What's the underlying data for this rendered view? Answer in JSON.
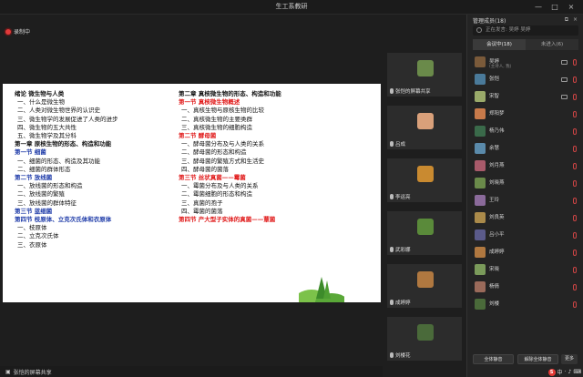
{
  "window": {
    "title": "生工系教研",
    "controls": [
      "—",
      "□",
      "×"
    ]
  },
  "recording": {
    "label": "录制中"
  },
  "slide": {
    "left": [
      {
        "text": "绪论 微生物与人类",
        "style": "h1"
      },
      {
        "text": "一、什么是微生物",
        "style": "ind"
      },
      {
        "text": "二、人类对微生物世界的认识史",
        "style": "ind"
      },
      {
        "text": "三、微生物学的发展促进了人类的进步",
        "style": "ind"
      },
      {
        "text": "四、微生物的五大共性",
        "style": "ind"
      },
      {
        "text": "五、微生物学及其分科",
        "style": "ind"
      },
      {
        "text": "第一章 原核生物的形态、构造和功能",
        "style": "h1"
      },
      {
        "text": "第一节 细菌",
        "style": "blue"
      },
      {
        "text": "一、细菌的形态、构造及其功能",
        "style": "ind"
      },
      {
        "text": "二、细菌的群体形态",
        "style": "ind"
      },
      {
        "text": "第二节 放线菌",
        "style": "blue"
      },
      {
        "text": "一、放线菌的形态和构造",
        "style": "ind"
      },
      {
        "text": "二、放线菌的繁殖",
        "style": "ind"
      },
      {
        "text": "三、放线菌的群体特征",
        "style": "ind"
      },
      {
        "text": "第三节 蓝细菌",
        "style": "blue"
      },
      {
        "text": "第四节 枝原体、立克次氏体和衣原体",
        "style": "blue"
      },
      {
        "text": "一、枝原体",
        "style": "ind"
      },
      {
        "text": "二、立克次氏体",
        "style": "ind"
      },
      {
        "text": "三、衣原体",
        "style": "ind"
      }
    ],
    "right": [
      {
        "text": "第二章 真核微生物的形态、构造和功能",
        "style": "h1"
      },
      {
        "text": "第一节 真核微生物概述",
        "style": "sec"
      },
      {
        "text": "一、真核生物与原核生物的比较",
        "style": "ind"
      },
      {
        "text": "二、真核微生物的主要类群",
        "style": "ind"
      },
      {
        "text": "三、真核微生物的细胞构造",
        "style": "ind"
      },
      {
        "text": "第二节 酵母菌",
        "style": "sec"
      },
      {
        "text": "一、酵母菌分布及与人类的关系",
        "style": "ind"
      },
      {
        "text": "二、酵母菌的形态和构造",
        "style": "ind"
      },
      {
        "text": "三、酵母菌的繁殖方式和生活史",
        "style": "ind"
      },
      {
        "text": "四、酵母菌的菌落",
        "style": "ind"
      },
      {
        "text": "第三节 丝状真菌——霉菌",
        "style": "sec"
      },
      {
        "text": "一、霉菌分布及与人类的关系",
        "style": "ind"
      },
      {
        "text": "二、霉菌细胞的形态和构造",
        "style": "ind"
      },
      {
        "text": "三、真菌的孢子",
        "style": "ind"
      },
      {
        "text": "四、霉菌的菌落",
        "style": "ind"
      },
      {
        "text": "第四节 产大型子实体的真菌——蕈菌",
        "style": "sec"
      }
    ]
  },
  "share_bar": {
    "label": "张恺的屏幕共享"
  },
  "video_tiles": [
    {
      "name": "张恺的屏幕共享",
      "color": "#6a8a4a"
    },
    {
      "name": "吕成",
      "color": "#d9a07a"
    },
    {
      "name": "李运亮",
      "color": "#c98a30"
    },
    {
      "name": "武彩娜",
      "color": "#5a8a3a"
    },
    {
      "name": "成婷婷",
      "color": "#b07840"
    },
    {
      "name": "刘楼花",
      "color": "#4a6a3a"
    }
  ],
  "panel": {
    "title": "管理成员(18)",
    "search_placeholder": "正在发言: 吴婷 吴婷",
    "tabs": [
      "会议中(18)",
      "未进入(6)"
    ],
    "members": [
      {
        "name": "吴婷",
        "sub": "(主持人, 我)",
        "color": "#7a5a3a"
      },
      {
        "name": "张恺",
        "sub": "",
        "color": "#4a7a9a"
      },
      {
        "name": "宋智",
        "sub": "",
        "color": "#9aaa6a"
      },
      {
        "name": "郑阳梦",
        "sub": "",
        "color": "#c87a4a"
      },
      {
        "name": "杨乃伟",
        "sub": "",
        "color": "#3a6a4a"
      },
      {
        "name": "余慧",
        "sub": "",
        "color": "#5a8aaa"
      },
      {
        "name": "刘月燕",
        "sub": "",
        "color": "#a85a6a"
      },
      {
        "name": "刘晓燕",
        "sub": "",
        "color": "#6a8a4a"
      },
      {
        "name": "王玲",
        "sub": "",
        "color": "#8a6a9a"
      },
      {
        "name": "刘良英",
        "sub": "",
        "color": "#aa8a4a"
      },
      {
        "name": "吕小平",
        "sub": "",
        "color": "#5a5a8a"
      },
      {
        "name": "成婷婷",
        "sub": "",
        "color": "#b07840"
      },
      {
        "name": "宋晓",
        "sub": "",
        "color": "#7a9a5a"
      },
      {
        "name": "杨倩",
        "sub": "",
        "color": "#9a6a5a"
      },
      {
        "name": "刘楼",
        "sub": "",
        "color": "#4a6a3a"
      }
    ],
    "buttons": [
      "全体静音",
      "解除全体静音"
    ],
    "more_label": "更多"
  },
  "tray": {
    "s_label": "S",
    "items": [
      "中",
      "·",
      "♪",
      "⌨"
    ]
  }
}
